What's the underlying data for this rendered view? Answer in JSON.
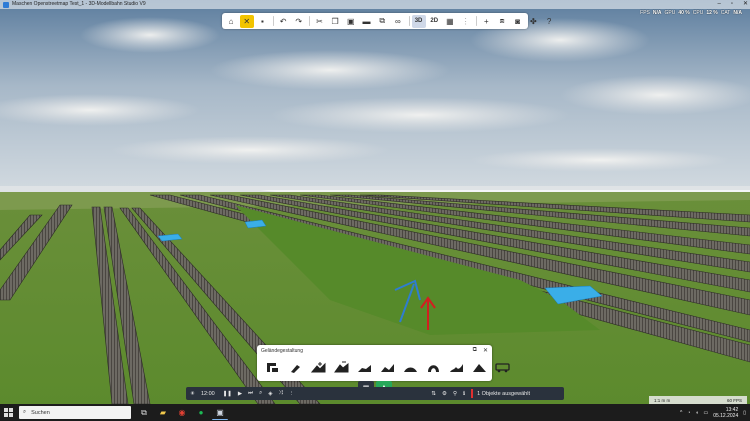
{
  "window": {
    "title": "Maschen Openstreetmap Test_1 - 3D-Modellbahn Studio V9",
    "minimize_icon": "minimize-icon",
    "maximize_icon": "maximize-icon",
    "close_icon": "close-icon"
  },
  "stats": {
    "fps_label": "FPS",
    "fps_value": "N/A",
    "gpu_label": "GPU",
    "gpu_value": "40 %",
    "cpu_label": "CPU",
    "cpu_value": "12 %",
    "cat_label": "CAT",
    "cat_value": "N/A"
  },
  "toolbar": {
    "items": [
      {
        "name": "home",
        "icon": "home-icon",
        "glyph": "⌂"
      },
      {
        "name": "edit-mode",
        "icon": "tools-icon",
        "glyph": "✕",
        "active": true
      },
      {
        "name": "save",
        "icon": "save-icon",
        "glyph": "▪"
      },
      {
        "name": "undo",
        "icon": "undo-icon",
        "glyph": "↶"
      },
      {
        "name": "redo",
        "icon": "redo-icon",
        "glyph": "↷"
      },
      {
        "name": "cut",
        "icon": "scissors-icon",
        "glyph": "✂"
      },
      {
        "name": "copy",
        "icon": "copy-icon",
        "glyph": "❐"
      },
      {
        "name": "paste",
        "icon": "paste-icon",
        "glyph": "▣"
      },
      {
        "name": "delete",
        "icon": "trash-icon",
        "glyph": "▬"
      },
      {
        "name": "group",
        "icon": "group-icon",
        "glyph": "⧉"
      },
      {
        "name": "link",
        "icon": "link-icon",
        "glyph": "∞"
      },
      {
        "name": "view-3d",
        "label": "3D"
      },
      {
        "name": "view-2d",
        "label": "2D"
      },
      {
        "name": "grid",
        "icon": "grid-icon",
        "glyph": "▦"
      },
      {
        "name": "snap",
        "icon": "snap-icon",
        "glyph": "⋮"
      },
      {
        "name": "add",
        "icon": "plus-icon",
        "glyph": "+"
      },
      {
        "name": "layers",
        "icon": "layers-icon",
        "glyph": "⧈"
      },
      {
        "name": "screenshot",
        "icon": "camera-icon",
        "glyph": "◙"
      },
      {
        "name": "plugins",
        "icon": "puzzle-icon",
        "glyph": "✤"
      },
      {
        "name": "help",
        "icon": "help-icon",
        "glyph": "?"
      }
    ]
  },
  "terrain_panel": {
    "title": "Geländegestaltung",
    "popout_icon": "popout-icon",
    "close_icon": "close-icon",
    "tools": [
      {
        "name": "select-area",
        "icon": "select-area-icon"
      },
      {
        "name": "paint",
        "icon": "brush-icon"
      },
      {
        "name": "raise",
        "icon": "raise-terrain-icon"
      },
      {
        "name": "lower",
        "icon": "lower-terrain-icon"
      },
      {
        "name": "flatten",
        "icon": "flatten-terrain-icon"
      },
      {
        "name": "smooth",
        "icon": "smooth-terrain-icon"
      },
      {
        "name": "level",
        "icon": "level-terrain-icon"
      },
      {
        "name": "hill",
        "icon": "hill-icon"
      },
      {
        "name": "tunnel",
        "icon": "tunnel-icon"
      },
      {
        "name": "random",
        "icon": "random-terrain-icon"
      },
      {
        "name": "railcar",
        "icon": "railcar-icon"
      }
    ]
  },
  "modes": [
    {
      "name": "objects",
      "icon": "catalog-icon",
      "glyph": "▦"
    },
    {
      "name": "terrain",
      "icon": "terrain-icon",
      "glyph": "▲",
      "active": true
    }
  ],
  "bottombar": {
    "sun_icon": "sun-icon",
    "time": "12:00",
    "status": "1 Objekte ausgewählt"
  },
  "scale": {
    "distance": "1:1 m m",
    "fps": "60 FPS"
  },
  "taskbar": {
    "search_placeholder": "Suchen",
    "apps": [
      {
        "name": "task-view",
        "glyph": "⧉"
      },
      {
        "name": "file-explorer",
        "glyph": "▰"
      },
      {
        "name": "chrome",
        "glyph": "◉"
      },
      {
        "name": "spotify",
        "glyph": "●"
      },
      {
        "name": "modellbahn",
        "glyph": "▣",
        "open": true
      }
    ],
    "clock_time": "13:42",
    "clock_date": "05.12.2024"
  },
  "colors": {
    "sky_top": "#5c7d9e",
    "sky_horizon": "#c9d4dc",
    "grass": "#5e8a2e",
    "accent": "#f2c400",
    "ui_dark": "#2a323d",
    "status_green": "#27a85a"
  }
}
